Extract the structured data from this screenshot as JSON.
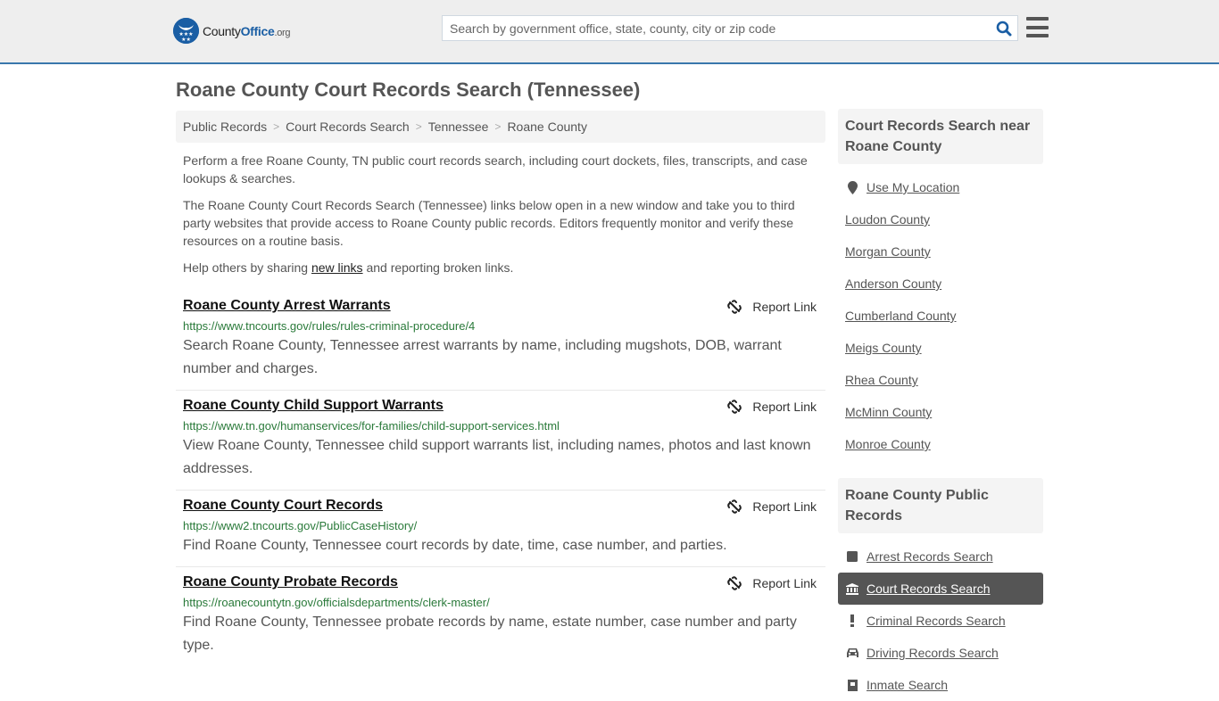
{
  "header": {
    "logo": {
      "county": "County",
      "office": "Office",
      "org": ".org"
    },
    "search_placeholder": "Search by government office, state, county, city or zip code",
    "search_value": ""
  },
  "colors": {
    "brand_blue": "#1a5ea4",
    "header_border": "#3a77ac",
    "url_green": "#2a7a3a",
    "active_item_bg": "#555555"
  },
  "page": {
    "title": "Roane County Court Records Search (Tennessee)",
    "breadcrumb": [
      "Public Records",
      "Court Records Search",
      "Tennessee",
      "Roane County"
    ],
    "intro": {
      "p1": "Perform a free Roane County, TN public court records search, including court dockets, files, transcripts, and case lookups & searches.",
      "p2": "The Roane County Court Records Search (Tennessee) links below open in a new window and take you to third party websites that provide access to Roane County public records. Editors frequently monitor and verify these resources on a routine basis.",
      "p3_before": "Help others by sharing ",
      "p3_link": "new links",
      "p3_after": " and reporting broken links."
    },
    "report_label": "Report Link",
    "results": [
      {
        "title": "Roane County Arrest Warrants",
        "url": "https://www.tncourts.gov/rules/rules-criminal-procedure/4",
        "desc": "Search Roane County, Tennessee arrest warrants by name, including mugshots, DOB, warrant number and charges."
      },
      {
        "title": "Roane County Child Support Warrants",
        "url": "https://www.tn.gov/humanservices/for-families/child-support-services.html",
        "desc": "View Roane County, Tennessee child support warrants list, including names, photos and last known addresses."
      },
      {
        "title": "Roane County Court Records",
        "url": "https://www2.tncourts.gov/PublicCaseHistory/",
        "desc": "Find Roane County, Tennessee court records by date, time, case number, and parties."
      },
      {
        "title": "Roane County Probate Records",
        "url": "https://roanecountytn.gov/officialsdepartments/clerk-master/",
        "desc": "Find Roane County, Tennessee probate records by name, estate number, case number and party type."
      }
    ]
  },
  "sidebar": {
    "near_heading": "Court Records Search near Roane County",
    "use_location": "Use My Location",
    "nearby": [
      "Loudon County",
      "Morgan County",
      "Anderson County",
      "Cumberland County",
      "Meigs County",
      "Rhea County",
      "McMinn County",
      "Monroe County"
    ],
    "public_heading": "Roane County Public Records",
    "public_records": [
      {
        "label": "Arrest Records Search",
        "icon": "square-icon",
        "glyph": "■",
        "active": false
      },
      {
        "label": "Court Records Search",
        "icon": "courthouse-icon",
        "glyph": "🏛",
        "active": true
      },
      {
        "label": "Criminal Records Search",
        "icon": "exclamation-icon",
        "glyph": "!",
        "active": false
      },
      {
        "label": "Driving Records Search",
        "icon": "car-icon",
        "glyph": "🚘",
        "active": false
      },
      {
        "label": "Inmate Search",
        "icon": "jail-icon",
        "glyph": "▮",
        "active": false
      }
    ]
  }
}
